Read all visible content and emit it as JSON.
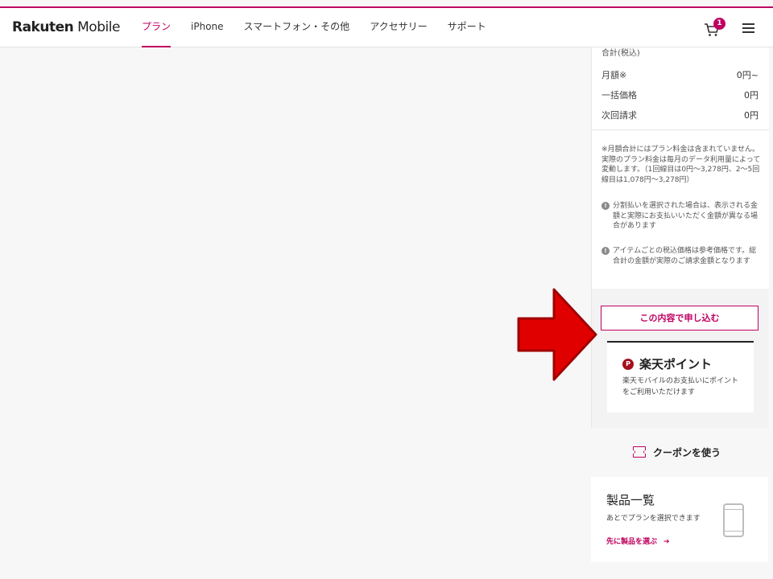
{
  "header": {
    "logo_bold": "Rakuten",
    "logo_light": " Mobile",
    "nav": [
      {
        "label": "プラン",
        "active": true
      },
      {
        "label": "iPhone"
      },
      {
        "label": "スマートフォン・その他"
      },
      {
        "label": "アクセサリー"
      },
      {
        "label": "サポート"
      }
    ],
    "cart_count": "1",
    "accent_color": "#bf0060"
  },
  "summary": {
    "title": "合計(税込)",
    "rows": [
      {
        "label": "月額※",
        "value": "0円~"
      },
      {
        "label": "一括価格",
        "value": "0円"
      },
      {
        "label": "次回請求",
        "value": "0円"
      }
    ],
    "note": "※月額合計にはプラン料金は含まれていません。実際のプラン料金は毎月のデータ利用量によって変動します。（1回線目は0円～3,278円、2～5回線目は1,078円～3,278円）",
    "info_items": [
      "分割払いを選択された場合は、表示される金額と実際にお支払いいただく金額が異なる場合があります",
      "アイテムごとの税込価格は参考価格です。総合計の金額が実際のご請求金額となります"
    ],
    "apply_button": "この内容で申し込む"
  },
  "points": {
    "logo_letter": "P",
    "title": "楽天ポイント",
    "description": "楽天モバイルのお支払いにポイントをご利用いただけます"
  },
  "coupon": {
    "label": "クーポンを使う"
  },
  "product_card": {
    "title": "製品一覧",
    "description": "あとでプランを選択できます",
    "link": "先に製品を選ぶ",
    "link_arrow": "➔"
  }
}
